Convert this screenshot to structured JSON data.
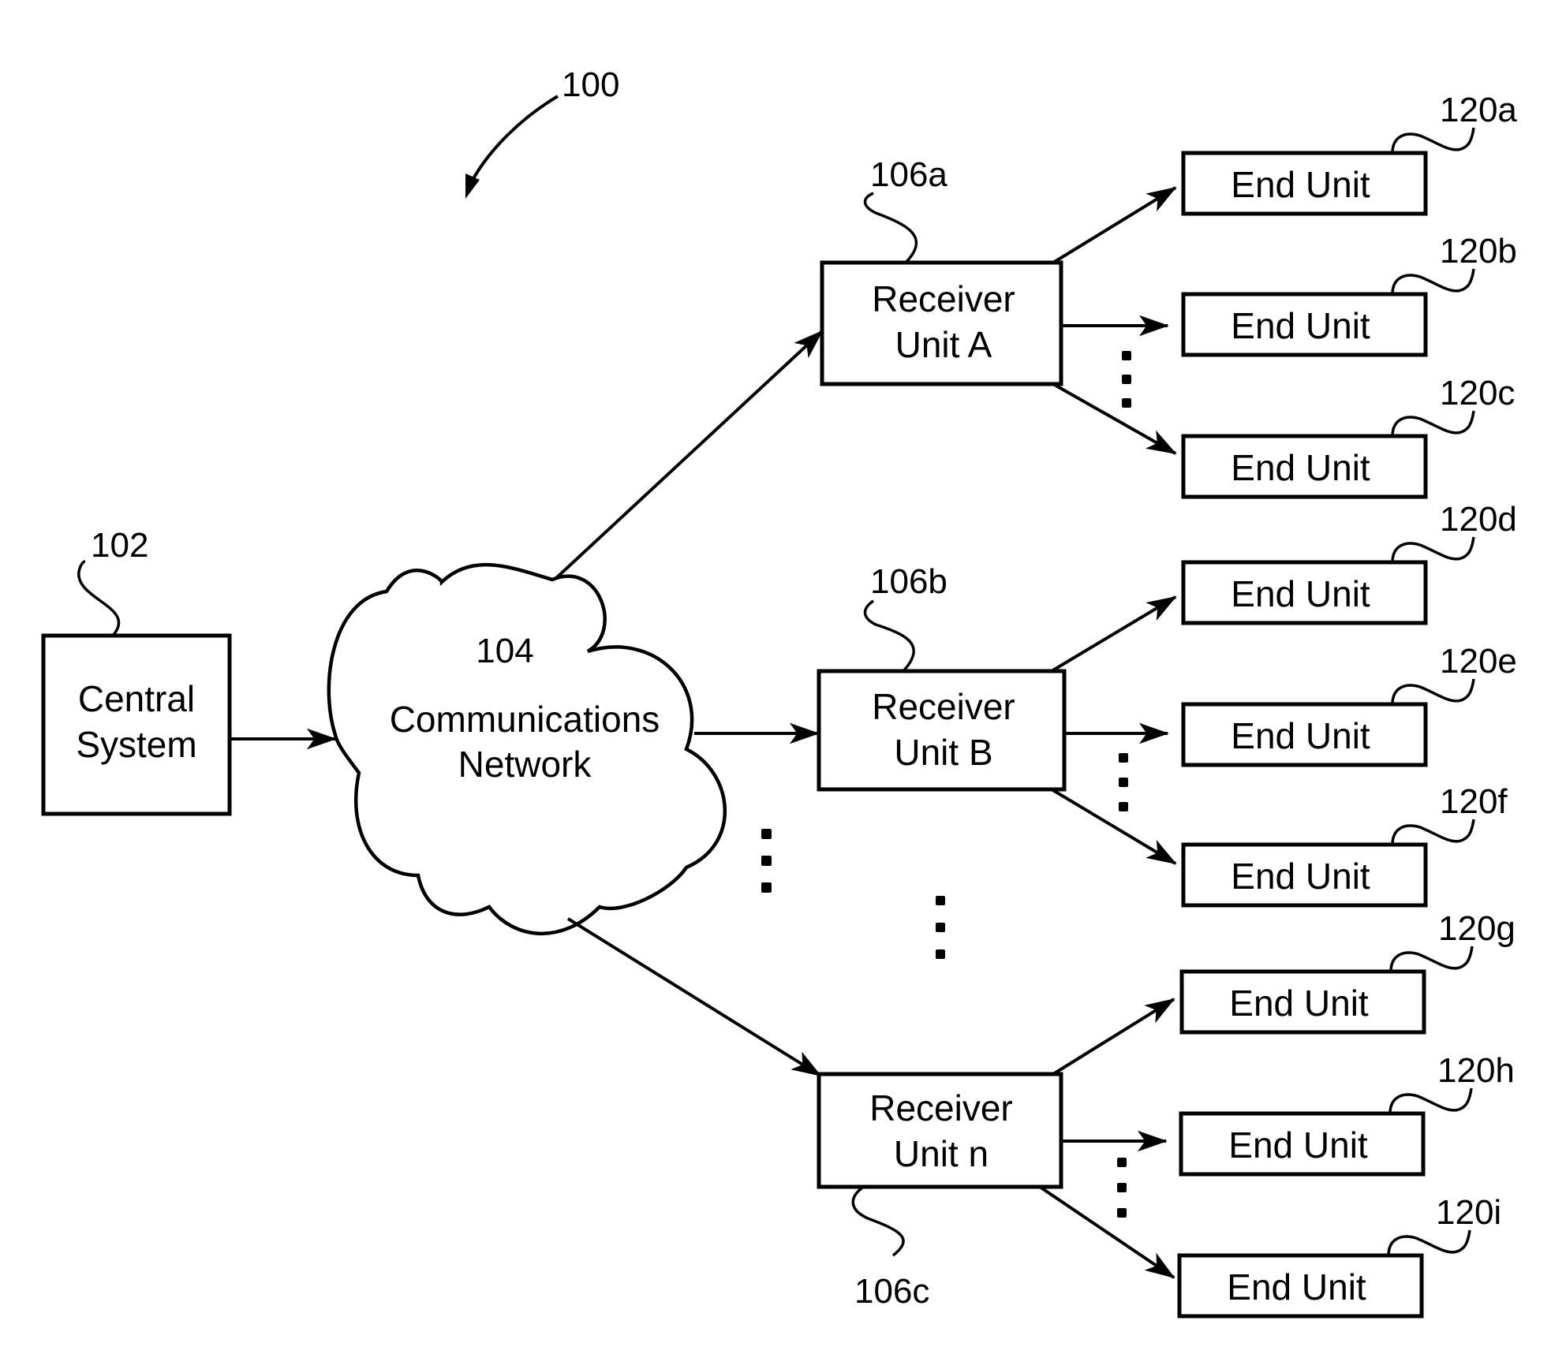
{
  "figure": {
    "ref": "100"
  },
  "central_system": {
    "ref": "102",
    "lines": [
      "Central",
      "System"
    ]
  },
  "network": {
    "ref": "104",
    "lines": [
      "Communications",
      "Network"
    ]
  },
  "receivers": [
    {
      "ref": "106a",
      "lines": [
        "Receiver",
        "Unit A"
      ]
    },
    {
      "ref": "106b",
      "lines": [
        "Receiver",
        "Unit B"
      ]
    },
    {
      "ref": "106c",
      "lines": [
        "Receiver",
        "Unit n"
      ]
    }
  ],
  "end_units": [
    {
      "ref": "120a",
      "label": "End Unit"
    },
    {
      "ref": "120b",
      "label": "End Unit"
    },
    {
      "ref": "120c",
      "label": "End Unit"
    },
    {
      "ref": "120d",
      "label": "End Unit"
    },
    {
      "ref": "120e",
      "label": "End Unit"
    },
    {
      "ref": "120f",
      "label": "End Unit"
    },
    {
      "ref": "120g",
      "label": "End Unit"
    },
    {
      "ref": "120h",
      "label": "End Unit"
    },
    {
      "ref": "120i",
      "label": "End Unit"
    }
  ]
}
